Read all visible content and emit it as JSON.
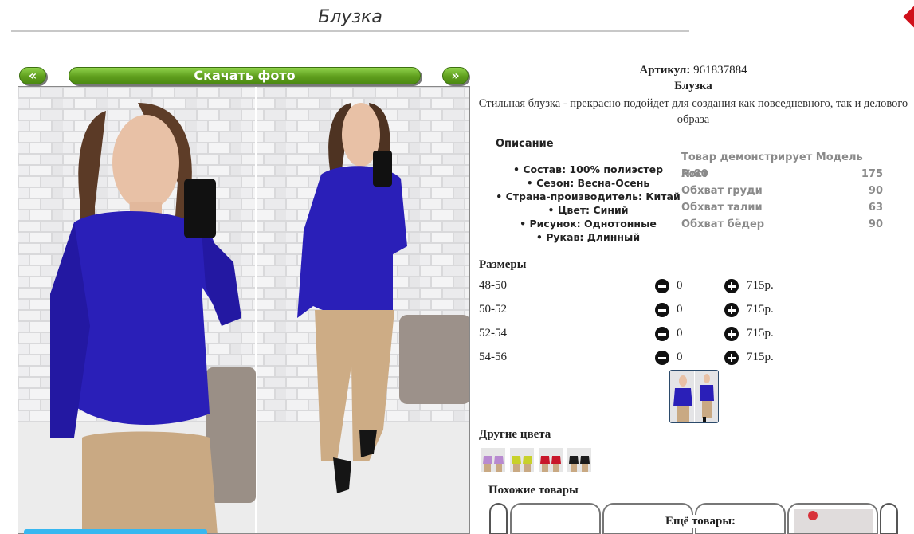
{
  "page": {
    "title": "Блузка"
  },
  "gallery": {
    "prev_label": "«",
    "next_label": "»",
    "download_label": "Скачать фото"
  },
  "product": {
    "article_label": "Артикул:",
    "article_value": "961837884",
    "name": "Блузка",
    "description": "Стильная блузка - прекрасно подойдет для создания как повседневного, так и делового образа"
  },
  "description_section": {
    "heading": "Описание",
    "properties": [
      "Состав: 100% полиэстер",
      "Сезон: Весна-Осень",
      "Страна-производитель: Китай",
      "Цвет: Синий",
      "Рисунок: Однотонные",
      "Рукав: Длинный"
    ]
  },
  "model": {
    "heading": "Товар демонстрирует Модель №80",
    "rows": [
      {
        "label": "Рост",
        "value": "175"
      },
      {
        "label": "Обхват груди",
        "value": "90"
      },
      {
        "label": "Обхват талии",
        "value": "63"
      },
      {
        "label": "Обхват бёдер",
        "value": "90"
      }
    ]
  },
  "sizes": {
    "heading": "Размеры",
    "rows": [
      {
        "size": "48-50",
        "qty": "0",
        "price": "715р."
      },
      {
        "size": "50-52",
        "qty": "0",
        "price": "715р."
      },
      {
        "size": "52-54",
        "qty": "0",
        "price": "715р."
      },
      {
        "size": "54-56",
        "qty": "0",
        "price": "715р."
      }
    ]
  },
  "other_colors": {
    "heading": "Другие цвета",
    "swatches": [
      "#b88ad0",
      "#c8d12a",
      "#c8162a",
      "#1a1a1a"
    ]
  },
  "similar": {
    "heading": "Похожие товары"
  },
  "more": {
    "heading": "Ещё товары:"
  },
  "colors": {
    "accent_green": "#5f9e1d",
    "blouse_blue": "#2a1fb8",
    "muted_gray": "#8a8a8a"
  }
}
